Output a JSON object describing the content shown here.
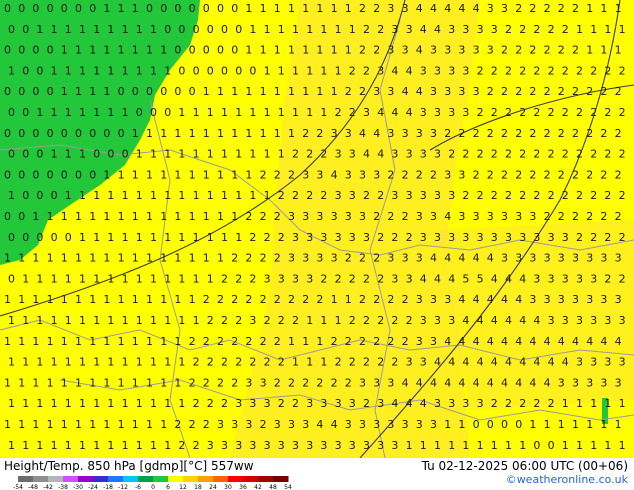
{
  "title": "Height/Temp. 850 hPa [gdmp][°C] 557ww",
  "valid_time": "Tu 02-12-2025 06:00 UTC (00+06)",
  "credit": "©weatheronline.co.uk",
  "legend": {
    "ticks": [
      "-54",
      "-48",
      "-42",
      "-38",
      "-30",
      "-24",
      "-18",
      "-12",
      "-6",
      "0",
      "6",
      "12",
      "18",
      "24",
      "30",
      "36",
      "42",
      "48",
      "54"
    ],
    "colors": [
      "#6c6c6c",
      "#8f8f8f",
      "#b5b5b5",
      "#d24dff",
      "#9900cc",
      "#3b2bcc",
      "#1e78ff",
      "#00c8ff",
      "#00a050",
      "#22c83a",
      "#ffff00",
      "#ffd200",
      "#ffa000",
      "#ff6400",
      "#ff0000",
      "#d20000",
      "#a00000",
      "#780000"
    ]
  },
  "colors": {
    "warm_field": "#ffff00",
    "cold_field": "#22c83a",
    "shading": "#ffe23c",
    "contour": "#3a3a3a",
    "borders": "#9b9b9b"
  },
  "map_labels": {
    "rows": [
      "0-0-0-0-0-0-0-1-1-1-0-0-0-0-0-0-0-1-1-1-1-1-1-1-1-2-2-3-3-4-4-4-4-4-3-3-2-2-2-2-2-1-1-1",
      "0-0-1-1-1-1-1-1-1-1-1-0-0-0-0-0-0-1-1-1-1-1-1-1-1-2-2-3-3-4-4-3-3-3-3-2-2-2-2-2-1-1-1-1",
      "0-0-0-0-1-1-1-1-1-1-1-1-0-0-0-0-0-1-1-1-1-1-1-1-1-2-2-3-3-4-3-3-3-3-3-2-2-2-2-2-2-1-1-1",
      "1-0-0-1-1-1-1-1-1-1-1-1-0-0-0-0-0-0-1-1-1-1-1-1-2-2-3-4-4-3-3-3-3-2-2-2-2-2-2-2-2-2-2-2",
      "0-0-0-0-1-1-1-1-0-0-0-0-0-0-1-1-1-1-1-1-1-1-1-1-2-2-3-3-4-4-3-3-3-3-2-2-2-2-2-2-2-2-2-2",
      "0-0-1-1-1-1-1-1-1-0-0-0-1-1-1-1-1-1-1-1-1-1-1-2-2-3-4-4-4-3-3-3-3-2-2-2-2-2-2-2-2-2-2-2",
      "0-0-0-0-0-0-0-0-0-1-1-1-1-1-1-1-1-1-1-1-1-2-2-3-3-4-4-3-3-3-3-2-2-2-2-2-2-2-2-2-2-2-2-2",
      "0-0-0-1-1-1-0-0-0-1-1-1-1-1-1-1-1-1-1-1-2-2-2-3-3-4-4-3-3-3-3-2-2-2-2-2-2-2-2-2-2-2-2-2",
      "0-0-0-0-0-0-0-1-1-1-1-1-1-1-1-1-1-1-2-2-2-3-3-4-3-3-3-2-2-2-2-3-3-2-2-2-2-2-2-2-2-2-2-2",
      "1-0-0-0-1-1-1-1-1-1-1-1-1-1-1-1-1-1-1-2-2-2-2-3-3-2-2-3-3-3-3-3-2-2-2-2-2-2-2-2-2-2-2-2",
      "0-0-1-1-1-1-1-1-1-1-1-1-1-1-1-1-1-2-2-2-3-3-3-3-3-3-2-2-2-3-3-4-3-3-3-3-3-3-2-2-2-2-2-2",
      "0-0-0-0-0-1-1-1-1-1-1-1-1-1-1-1-1-2-2-2-3-3-3-3-3-3-2-2-2-3-3-3-3-3-3-3-3-3-3-3-2-2-2-2",
      "1-1-1-1-1-1-1-1-1-1-1-1-1-1-1-1-2-2-2-2-3-3-3-3-2-2-2-3-3-3-4-4-4-4-4-3-3-3-3-3-3-3-3-3",
      "0-1-1-1-1-1-1-1-1-1-1-1-1-1-1-2-2-2-3-3-3-3-2-2-2-2-2-3-3-4-4-4-5-5-4-4-4-3-3-3-3-3-2-2",
      "1-1-1-1-1-1-1-1-1-1-1-1-1-1-2-2-2-2-2-2-2-2-2-1-1-2-2-2-2-3-3-3-4-4-4-4-4-3-3-3-3-3-3-3",
      "1-1-1-1-1-1-1-1-1-1-1-1-1-1-2-2-2-3-2-2-2-1-1-1-2-2-2-2-2-3-3-3-4-4-4-4-4-4-3-3-3-3-3-3",
      "1-1-1-1-1-1-1-1-1-1-1-1-1-2-2-2-2-2-2-2-1-1-1-2-2-2-2-2-2-3-3-4-4-4-4-4-4-4-4-4-4-4-4-4",
      "1-1-1-1-1-1-1-1-1-1-1-1-1-2-2-2-2-2-2-2-1-1-1-2-2-2-2-2-3-3-4-4-4-4-4-4-4-4-4-4-3-3-3-3",
      "1-1-1-1-1-1-1-1-1-1-1-1-1-2-2-2-2-3-3-2-2-2-2-2-2-3-3-3-4-4-4-4-4-4-4-4-4-4-4-3-3-3-3-3",
      "1-1-1-1-1-1-1-1-1-1-1-1-1-2-2-2-3-3-3-2-2-3-3-3-3-2-3-4-4-4-3-3-3-3-2-2-2-2-2-1-1-1-1-1",
      "1-1-1-1-1-1-1-1-1-1-1-1-2-2-2-3-3-3-2-3-3-3-4-4-3-3-3-3-3-3-3-1-1-0-0-0-0-1-1-1-1-1-1-1",
      "1-1-1-1-1-1-1-1-1-1-1-1-2-2-3-3-3-3-3-3-3-3-3-3-3-3-3-3-1-1-1-1-1-1-1-1-1-0-0-1-1-1-1-1"
    ]
  }
}
